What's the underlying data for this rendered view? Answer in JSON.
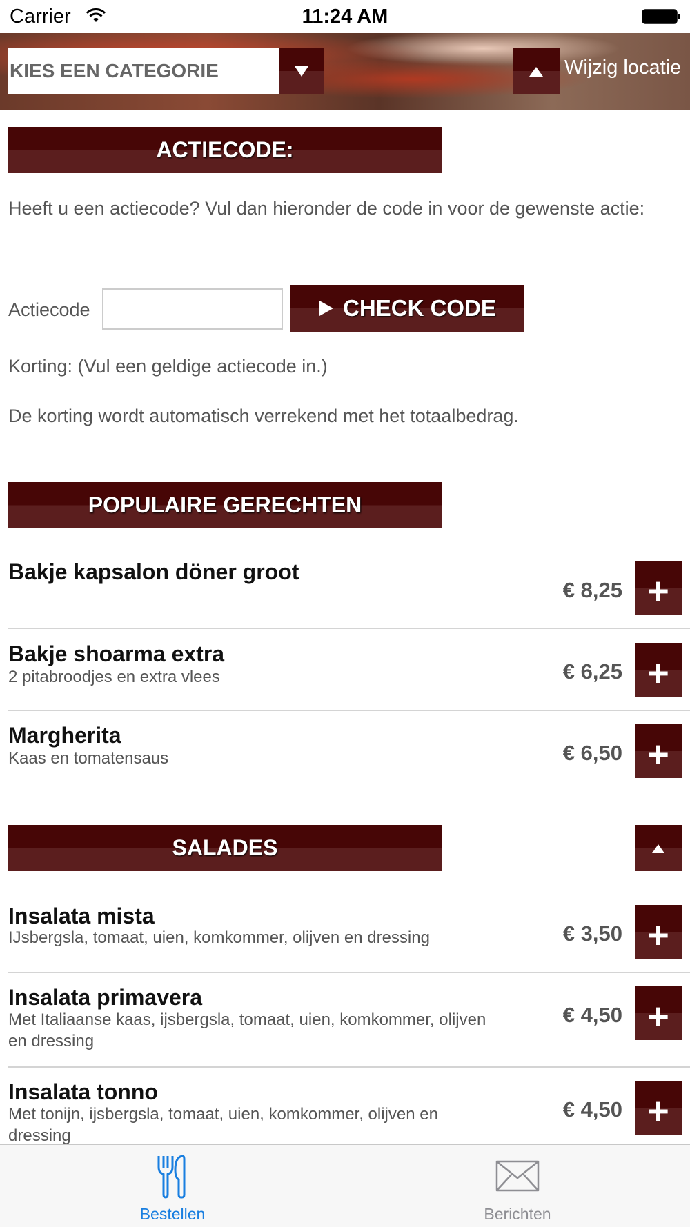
{
  "status_bar": {
    "carrier": "Carrier",
    "time": "11:24 AM"
  },
  "top_bar": {
    "category_select": "KIES EEN CATEGORIE",
    "location_label": "Wijzig locatie"
  },
  "actiecode": {
    "header": "ACTIECODE:",
    "intro": "Heeft u een actiecode? Vul dan hieronder de code in voor de gewenste actie:",
    "input_label": "Actiecode",
    "input_value": "",
    "check_button": "CHECK CODE",
    "korting": "Korting: (Vul een geldige actiecode in.)",
    "note": "De korting wordt automatisch verrekend met het totaalbedrag."
  },
  "popular": {
    "header": "POPULAIRE GERECHTEN",
    "items": [
      {
        "name": "Bakje kapsalon döner groot",
        "desc": "",
        "price": "€ 8,25"
      },
      {
        "name": "Bakje shoarma extra",
        "desc": "2 pitabroodjes en extra vlees",
        "price": "€ 6,25"
      },
      {
        "name": "Margherita",
        "desc": "Kaas en tomatensaus",
        "price": "€ 6,50"
      }
    ]
  },
  "salades": {
    "header": "SALADES",
    "items": [
      {
        "name": "Insalata mista",
        "desc": "IJsbergsla, tomaat, uien, komkommer, olijven en dressing",
        "price": "€ 3,50"
      },
      {
        "name": "Insalata primavera",
        "desc": "Met Italiaanse kaas, ijsbergsla, tomaat, uien, komkommer, olijven en dressing",
        "price": "€ 4,50"
      },
      {
        "name": "Insalata tonno",
        "desc": "Met tonijn, ijsbergsla, tomaat, uien, komkommer, olijven en dressing",
        "price": "€ 4,50"
      }
    ]
  },
  "add_symbol": "+",
  "tab_bar": {
    "tabs": [
      {
        "label": "Bestellen"
      },
      {
        "label": "Berichten"
      }
    ]
  },
  "colors": {
    "accent_dark": "#470606",
    "accent_light": "#5b1e1e",
    "tab_active": "#1a7fe0",
    "tab_inactive": "#8e8e93"
  }
}
